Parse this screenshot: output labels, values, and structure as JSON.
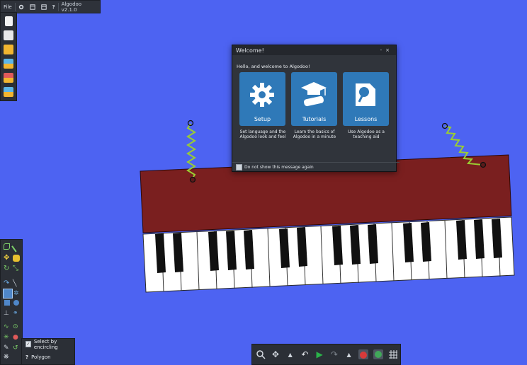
{
  "topbar": {
    "file": "File",
    "help": "?",
    "version": "Algodoo v2.1.0"
  },
  "left_toolbar": {
    "icons": [
      "new-scene-icon",
      "scene-settings-icon",
      "open-folder-icon",
      "algobox-icon",
      "photo-icon",
      "save-icon"
    ]
  },
  "tool_options": {
    "select_by_encircling": "Select by encircling",
    "polygon": "Polygon",
    "polygon_help": "?"
  },
  "welcome": {
    "title": "Welcome!",
    "minimize": "-",
    "close": "×",
    "greeting": "Hello, and welcome to Algodoo!",
    "cards": [
      {
        "label": "Setup",
        "desc": "Set language and the Algodoo look and feel"
      },
      {
        "label": "Tutorials",
        "desc": "Learn the basics of Algodoo in a minute"
      },
      {
        "label": "Lessons",
        "desc": "Use Algodoo as a teaching aid"
      }
    ],
    "dont_show": "Do not show this message again"
  },
  "colors": {
    "background": "#4d63f2",
    "piano_body": "#7a1f1f",
    "spring": "#9acd32",
    "accent": "#2f79b8"
  }
}
